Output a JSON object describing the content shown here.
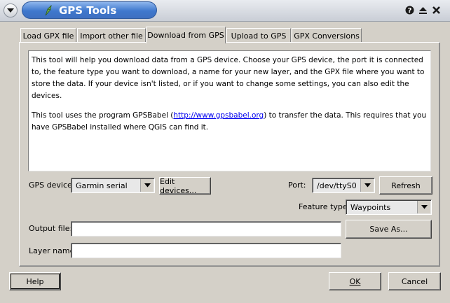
{
  "window": {
    "title": "GPS Tools"
  },
  "tabs": [
    {
      "label": "Load GPX file"
    },
    {
      "label": "Import other file"
    },
    {
      "label": "Download from GPS",
      "active": true
    },
    {
      "label": "Upload to GPS"
    },
    {
      "label": "GPX Conversions"
    }
  ],
  "description": {
    "para1": "This tool will help you download data from a GPS device. Choose your GPS device, the port it is connected to, the feature type you want to download, a name for your new layer, and the GPX file where you want to store the data. If your device isn't listed, or if you want to change some settings, you can also edit the devices.",
    "para2_pre": "This tool uses the program GPSBabel (",
    "para2_link": "http://www.gpsbabel.org",
    "para2_post": ") to transfer the data. This requires that you have GPSBabel installed where QGIS can find it."
  },
  "form": {
    "gps_device_label": "GPS device:",
    "gps_device_value": "Garmin serial",
    "edit_devices_label": "Edit devices...",
    "port_label": "Port:",
    "port_value": "/dev/ttyS0",
    "refresh_label": "Refresh",
    "feature_type_label": "Feature type:",
    "feature_type_value": "Waypoints",
    "output_file_label": "Output file:",
    "output_file_value": "",
    "save_as_label": "Save As...",
    "layer_name_label": "Layer name:",
    "layer_name_value": ""
  },
  "buttons": {
    "help": "Help",
    "ok": "OK",
    "cancel": "Cancel"
  },
  "colors": {
    "title_bar_accent": "#3f78cd",
    "link": "#0000ee"
  }
}
